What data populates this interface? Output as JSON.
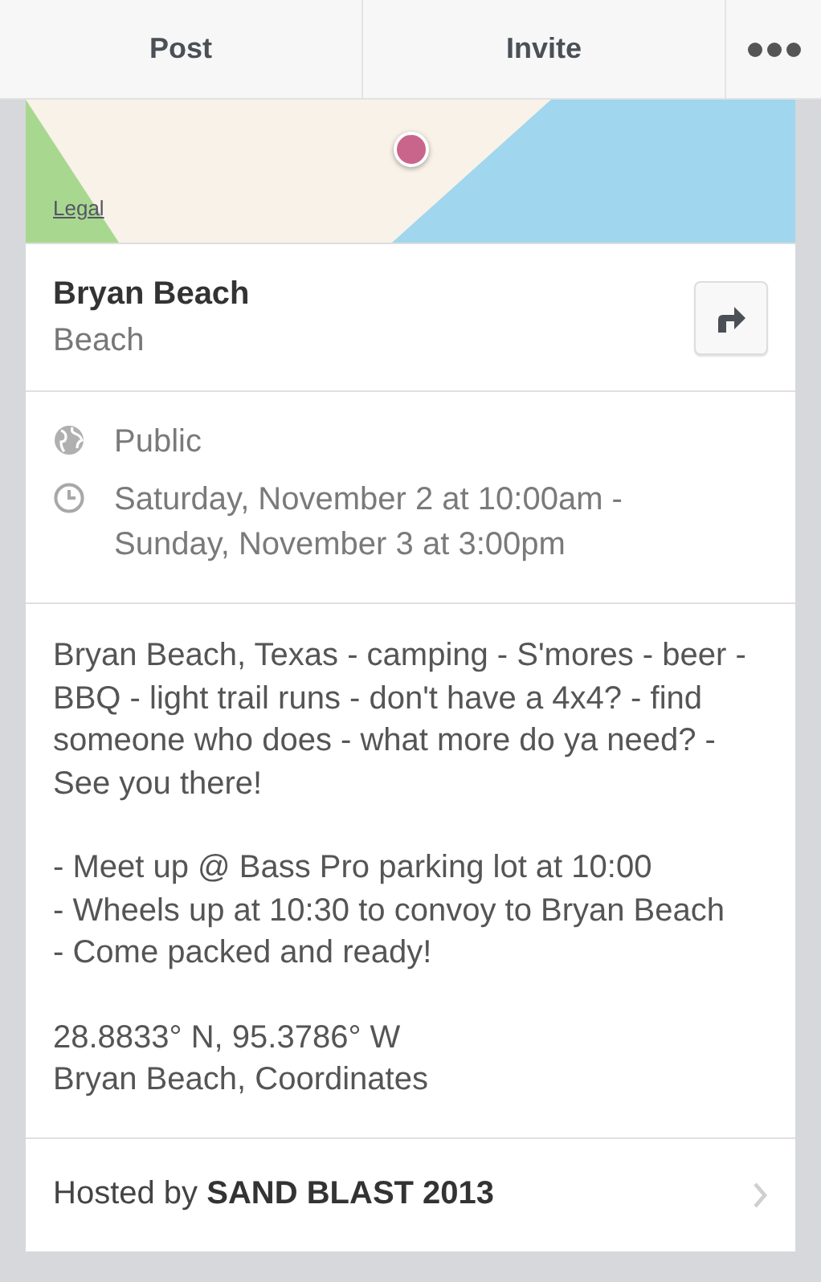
{
  "toolbar": {
    "buttons": [
      {
        "label": "Post"
      },
      {
        "label": "Invite"
      }
    ]
  },
  "map": {
    "kind": "picture",
    "legal_link": "Legal"
  },
  "place": {
    "name": "Bryan Beach",
    "category": "Beach"
  },
  "details": [
    {
      "kind": "privacy",
      "text": "Public"
    },
    {
      "kind": "time",
      "text": "Saturday, November 2 at 10:00am - Sunday, November 3 at 3:00pm"
    }
  ],
  "description": [
    [
      "Bryan Beach, Texas - camping - S'mores - beer - BBQ - light trail runs - don't have a 4x4? - find someone who does - what more do ya need? - See you there!"
    ],
    [
      "- Meet up @ Bass Pro parking lot at 10:00",
      "- Wheels up at 10:30 to convoy to Bryan Beach",
      "- Come packed and ready!"
    ],
    [
      "28.8833° N, 95.3786° W",
      "Bryan Beach, Coordinates"
    ]
  ],
  "host": {
    "text": "Hosted by **SAND BLAST 2013**"
  }
}
